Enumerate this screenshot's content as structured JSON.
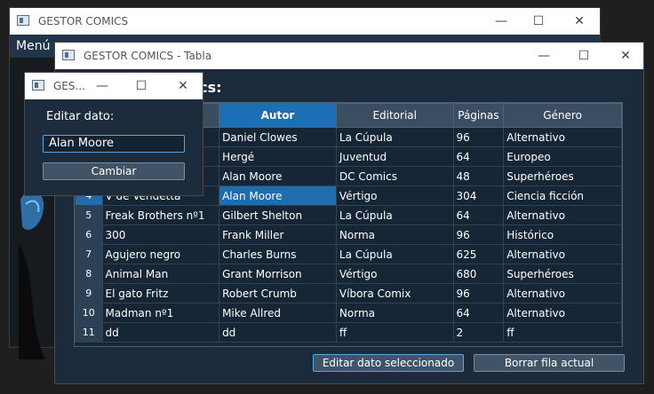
{
  "main_window": {
    "title": "GESTOR COMICS",
    "menu_label": "Menú p",
    "controls": {
      "minimize": "—",
      "maximize": "☐",
      "close": "✕"
    }
  },
  "table_window": {
    "title": "GESTOR COMICS - Tabla",
    "heading": "mics:",
    "controls": {
      "minimize": "—",
      "maximize": "☐",
      "close": "✕"
    },
    "columns": [
      "",
      "Autor",
      "Editorial",
      "Páginas",
      "Género"
    ],
    "rows": [
      {
        "num": "",
        "titulo": "",
        "autor": "Daniel Clowes",
        "editorial": "La Cúpula",
        "paginas": "96",
        "genero": "Alternativo"
      },
      {
        "num": "",
        "titulo": "",
        "autor": "Hergé",
        "editorial": "Juventud",
        "paginas": "64",
        "genero": "Europeo"
      },
      {
        "num": "",
        "titulo": "",
        "autor": "Alan Moore",
        "editorial": "DC Comics",
        "paginas": "48",
        "genero": "Superhéroes"
      },
      {
        "num": "4",
        "titulo": "V de Vendetta",
        "autor": "Alan Moore",
        "editorial": "Vértigo",
        "paginas": "304",
        "genero": "Ciencia ficción"
      },
      {
        "num": "5",
        "titulo": "Freak Brothers nº1",
        "autor": "Gilbert Shelton",
        "editorial": "La Cúpula",
        "paginas": "64",
        "genero": "Alternativo"
      },
      {
        "num": "6",
        "titulo": "300",
        "autor": "Frank Miller",
        "editorial": "Norma",
        "paginas": "96",
        "genero": "Histórico"
      },
      {
        "num": "7",
        "titulo": "Agujero negro",
        "autor": "Charles Burns",
        "editorial": "La Cúpula",
        "paginas": "625",
        "genero": "Alternativo"
      },
      {
        "num": "8",
        "titulo": "Animal Man",
        "autor": "Grant Morrison",
        "editorial": "Vértigo",
        "paginas": "680",
        "genero": "Superhéroes"
      },
      {
        "num": "9",
        "titulo": "El gato Fritz",
        "autor": "Robert Crumb",
        "editorial": "Víbora Comix",
        "paginas": "96",
        "genero": "Alternativo"
      },
      {
        "num": "10",
        "titulo": "Madman nº1",
        "autor": "Mike Allred",
        "editorial": "Norma",
        "paginas": "64",
        "genero": "Alternativo"
      },
      {
        "num": "11",
        "titulo": "dd",
        "autor": "dd",
        "editorial": "ff",
        "paginas": "2",
        "genero": "ff"
      }
    ],
    "selected_row_index": 3,
    "selected_column": "Autor",
    "buttons": {
      "edit": "Editar dato seleccionado",
      "delete": "Borrar fila actual"
    }
  },
  "edit_window": {
    "title": "GES...",
    "controls": {
      "minimize": "—",
      "maximize": "☐",
      "close": "✕"
    },
    "label": "Editar dato:",
    "input_value": "Alan Moore",
    "button": "Cambiar"
  },
  "colors": {
    "accent": "#1d6db0",
    "panel": "#1c2b3b",
    "header": "#3b4d60"
  }
}
